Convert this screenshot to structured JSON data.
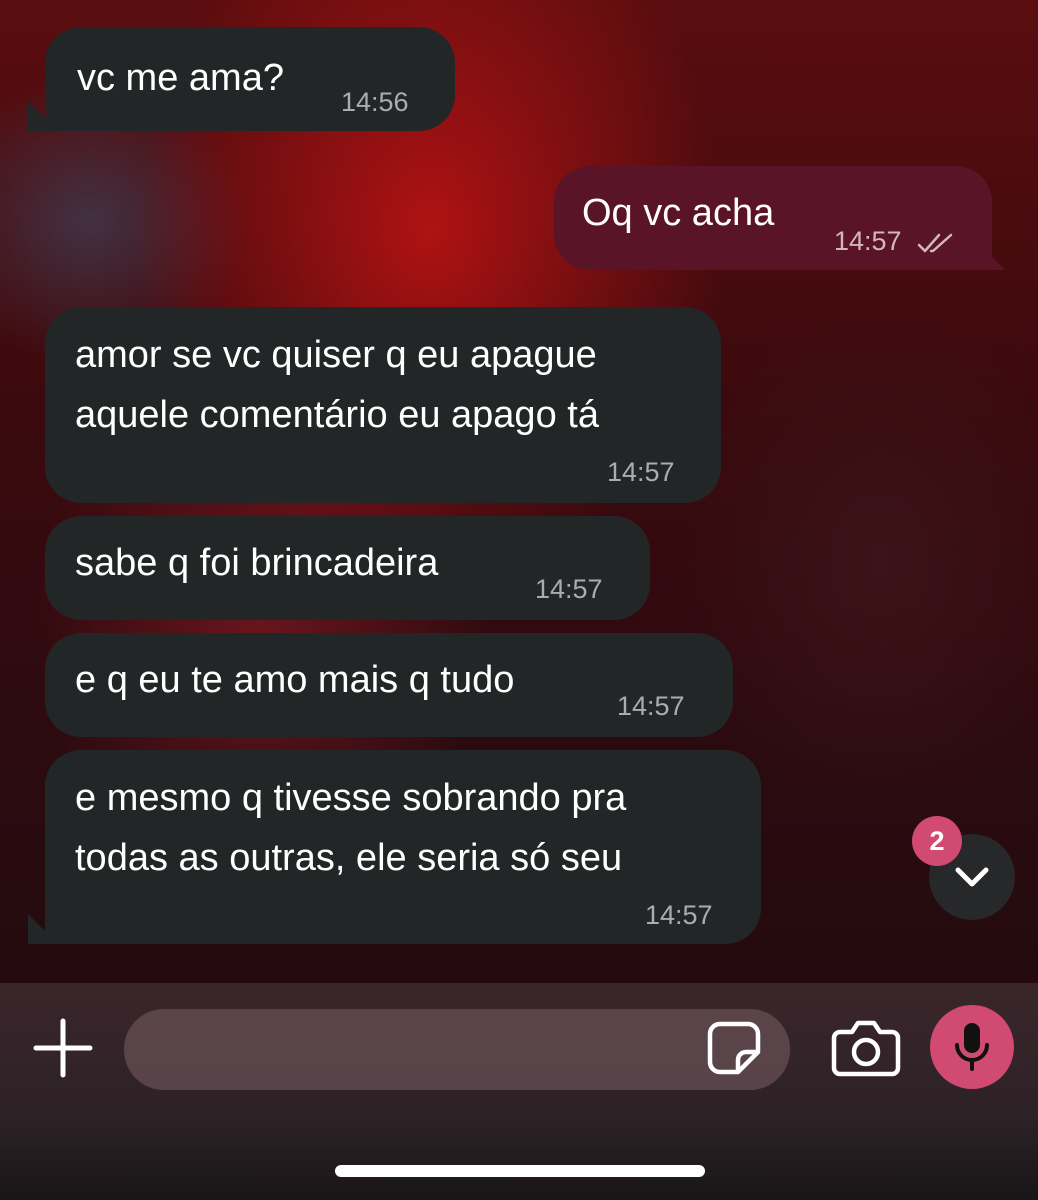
{
  "messages": [
    {
      "text": "vc me ama?",
      "time": "14:56",
      "direction": "incoming"
    },
    {
      "text": "Oq vc acha",
      "time": "14:57",
      "direction": "outgoing",
      "status": "read"
    },
    {
      "text": "amor se vc quiser q eu apague\naquele comentário eu apago tá",
      "time": "14:57",
      "direction": "incoming"
    },
    {
      "text": "sabe q foi brincadeira",
      "time": "14:57",
      "direction": "incoming"
    },
    {
      "text": "e q eu te amo mais q tudo",
      "time": "14:57",
      "direction": "incoming"
    },
    {
      "text": "e mesmo q tivesse sobrando pra\ntodas as outras, ele seria só seu",
      "time": "14:57",
      "direction": "incoming"
    }
  ],
  "scroll_down": {
    "unread_count": "2",
    "icon": "chevron-down-icon"
  },
  "composer": {
    "placeholder": "",
    "icons": [
      "plus-icon",
      "sticker-icon",
      "camera-icon",
      "microphone-icon"
    ]
  },
  "colors": {
    "incoming_bubble": "#232626",
    "outgoing_bubble": "#5a1428",
    "accent": "#d14a72"
  }
}
